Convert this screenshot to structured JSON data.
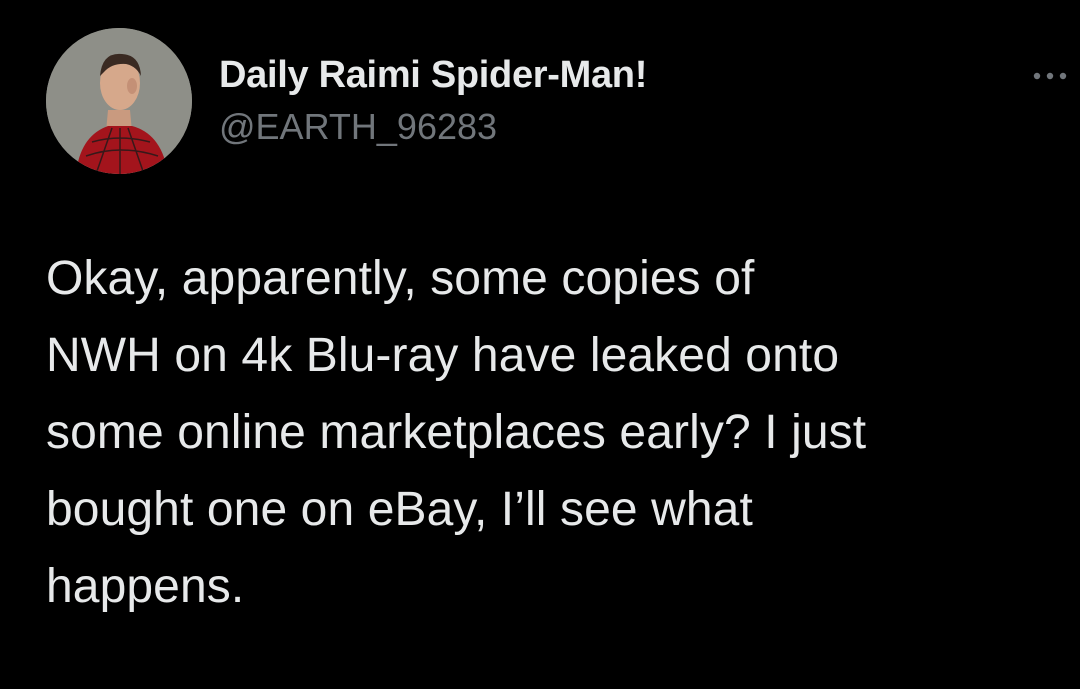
{
  "tweet": {
    "author": {
      "display_name": "Daily Raimi Spider-Man!",
      "handle": "@EARTH_96283",
      "avatar_icon": "profile-photo-icon"
    },
    "more_icon": "more-horizontal-icon",
    "text": "Okay, apparently, some copies of\nNWH on 4k Blu-ray have leaked onto\nsome online marketplaces early? I just\nbought one on eBay, I’ll see what\nhappens."
  },
  "colors": {
    "background": "#000000",
    "primary_text": "#e7e9ea",
    "secondary_text": "#71767b"
  }
}
